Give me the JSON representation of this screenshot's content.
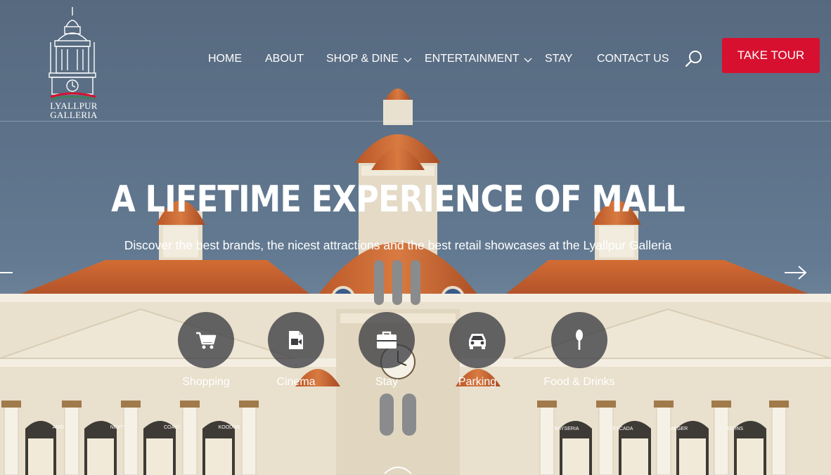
{
  "site": {
    "logo_line1": "LYALLPUR",
    "logo_line2": "GALLERIA"
  },
  "nav": {
    "items": [
      {
        "label": "HOME",
        "dropdown": false
      },
      {
        "label": "ABOUT",
        "dropdown": false
      },
      {
        "label": "SHOP & DINE",
        "dropdown": true
      },
      {
        "label": "ENTERTAINMENT",
        "dropdown": true
      },
      {
        "label": "STAY",
        "dropdown": false
      },
      {
        "label": "CONTACT US",
        "dropdown": false
      }
    ],
    "search_icon": "search-icon",
    "cta_label": "TAKE TOUR"
  },
  "hero": {
    "title": "A LIFETIME EXPERIENCE OF MALL",
    "subtitle": "Discover the best brands, the nicest attractions and the best retail showcases at the Lyallpur Galleria",
    "prev_icon": "arrow-left-icon",
    "next_icon": "arrow-right-icon"
  },
  "features": [
    {
      "label": "Shopping",
      "icon": "cart-icon"
    },
    {
      "label": "Cinema",
      "icon": "film-icon"
    },
    {
      "label": "Stay",
      "icon": "briefcase-icon"
    },
    {
      "label": "Parking",
      "icon": "car-icon"
    },
    {
      "label": "Food & Drinks",
      "icon": "spoon-icon"
    }
  ],
  "storefront_signs": [
    "ADID",
    "NEXT",
    "COAST",
    "KOODOS",
    "RAYSERIA",
    "ESCADA",
    "AEGER",
    "ODINS"
  ],
  "colors": {
    "sky": "#5b7089",
    "roof": "#c8612f",
    "stone": "#ece3d1",
    "cta": "#d7102f",
    "feature_circle": "#3c3e42"
  }
}
